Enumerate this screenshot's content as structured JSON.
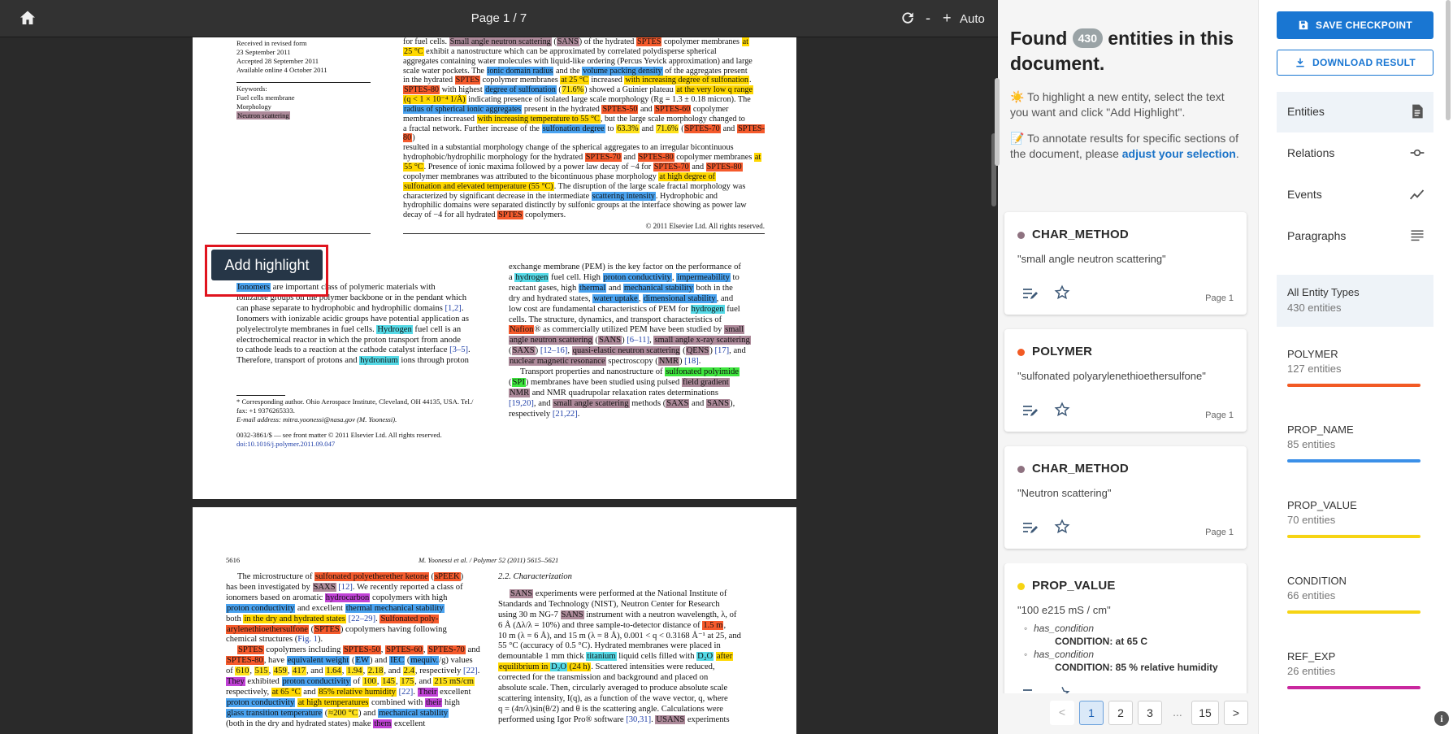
{
  "toolbar": {
    "page_label": "Page 1 / 7",
    "zoom_out": "-",
    "zoom_in": "+",
    "zoom_mode": "Auto"
  },
  "add_highlight": {
    "label": "Add highlight"
  },
  "summary": {
    "found_prefix": "Found",
    "count": "430",
    "found_suffix": "entities in this document.",
    "tip1": "To highlight a new entity, select the text you want and click \"Add Highlight\".",
    "tip2_prefix": "To annotate results for specific sections of the document, please",
    "tip2_link": "adjust your selection",
    "tip2_suffix": ".",
    "tip1_emoji": "☀️",
    "tip2_emoji": "📝"
  },
  "cards": [
    {
      "type": "CHAR_METHOD",
      "text": "\"small angle neutron scattering\"",
      "page": "Page 1",
      "color": "#8e7280"
    },
    {
      "type": "POLYMER",
      "text": "\"sulfonated polyarylenethioethersulfone\"",
      "page": "Page 1",
      "color": "#f25a24"
    },
    {
      "type": "CHAR_METHOD",
      "text": "\"Neutron scattering\"",
      "page": "Page 1",
      "color": "#8e7280"
    },
    {
      "type": "PROP_VALUE",
      "text": "\"100 e215 mS / cm\"",
      "page": "",
      "color": "#f6d413",
      "conditions": [
        {
          "key": "has_condition",
          "value": "CONDITION: at 65 C"
        },
        {
          "key": "has_condition",
          "value": "CONDITION: 85 % relative humidity"
        }
      ]
    }
  ],
  "pagination": {
    "prev": "<",
    "pages": [
      "1",
      "2",
      "3"
    ],
    "dots": "...",
    "last": "15",
    "next": ">"
  },
  "sidebar": {
    "save": "SAVE CHECKPOINT",
    "download": "DOWNLOAD RESULT",
    "nav": [
      {
        "label": "Entities",
        "icon": "document-icon"
      },
      {
        "label": "Relations",
        "icon": "relation-icon"
      },
      {
        "label": "Events",
        "icon": "trend-icon"
      },
      {
        "label": "Paragraphs",
        "icon": "paragraph-icon"
      }
    ],
    "all_types": {
      "label": "All Entity Types",
      "count": "430 entities"
    },
    "types": [
      {
        "name": "POLYMER",
        "count": "127 entities",
        "color": "#f25a24"
      },
      {
        "name": "PROP_NAME",
        "count": "85 entities",
        "color": "#3b90e8"
      },
      {
        "name": "PROP_VALUE",
        "count": "70 entities",
        "color": "#f6d413"
      },
      {
        "name": "CONDITION",
        "count": "66 entities",
        "color": "#f6d413"
      },
      {
        "name": "REF_EXP",
        "count": "26 entities",
        "color": "#c9279e"
      }
    ]
  },
  "doc": {
    "p1_history": [
      "Received in revised form",
      "23 September 2011",
      "Accepted 28 September 2011",
      "Available online 4 October 2011"
    ],
    "p1_keywords_title": "Keywords:",
    "p1_keywords": [
      "Fuel cells membrane",
      "Morphology",
      "Neutron scattering"
    ],
    "p1_abs_lines": [
      "for fuel cells. Small angle neutron scattering (SANS) of the hydrated SPTES copolymer membranes at",
      "25 °C exhibit a nanostructure which can be approximated by correlated polydisperse spherical",
      "aggregates containing water molecules with liquid-like ordering (Percus Yevick approximation) and large",
      "scale water pockets. The ionic domain radius and the volume packing density of the aggregates present",
      "in the hydrated SPTES copolymer membranes at 25 °C increased with increasing degree of sulfonation.",
      "SPTES-80 with highest degree of sulfonation (71.6%) showed a Guinier plateau at the very low q range",
      "(q < 1 × 10⁻⁴ 1/Å) indicating presence of isolated large scale morphology (Rg = 1.3 ± 0.18 micron). The",
      "radius of spherical ionic aggregates present in the hydrated SPTES-50 and SPTES-60 copolymer",
      "membranes increased with increasing temperature to 55 °C, but the large scale morphology changed to",
      "a fractal network. Further increase of the sulfonation degree to 63.3% and 71.6% (SPTES-70 and SPTES-80)",
      "resulted in a substantial morphology change of the spherical aggregates to an irregular bicontinuous",
      "hydrophobic/hydrophilic morphology for the hydrated SPTES-70 and SPTES-80 copolymer membranes at",
      "55 °C. Presence of ionic maxima followed by a power law decay of −4 for SPTES-70 and SPTES-80",
      "copolymer membranes was attributed to the bicontinuous phase morphology at high degree of",
      "sulfonation and elevated temperature (55 °C). The disruption of the large scale fractal morphology was",
      "characterized by significant decrease in the intermediate scattering intensity. Hydrophobic and",
      "hydrophilic domains were separated distinctly by sulfonic groups at the interface showing as power law",
      "decay of −4 for all hydrated SPTES copolymers."
    ],
    "p1_copyright": "© 2011 Elsevier Ltd. All rights reserved.",
    "p1_intro_left": [
      "Ionomers are important class of polymeric materials with",
      "ionizable groups on the polymer backbone or in the pendant which",
      "can phase separate to hydrophobic and hydrophilic domains [1,2].",
      "Ionomers with ionizable acidic groups have potential application as",
      "polyelectrolyte membranes in fuel cells. Hydrogen fuel cell is an",
      "electrochemical reactor in which the proton transport from anode",
      "to cathode leads to a reaction at the cathode catalyst interface [3–5].",
      "Therefore, transport of protons and hydronium ions through proton"
    ],
    "p1_footnote": [
      "* Corresponding author. Ohio Aerospace Institute, Cleveland, OH 44135, USA. Tel./",
      "fax: +1 9376265333.",
      "E-mail address: mitra.yoonessi@nasa.gov (M. Yoonessi)."
    ],
    "p1_doi": [
      "0032-3861/$ — see front matter © 2011 Elsevier Ltd. All rights reserved.",
      "doi:10.1016/j.polymer.2011.09.047"
    ],
    "p1_intro_right": [
      "exchange membrane (PEM) is the key factor on the performance of",
      "a hydrogen fuel cell. High proton conductivity, impermeability to",
      "reactant gases, high thermal and mechanical stability both in the",
      "dry and hydrated states, water uptake, dimensional stability, and",
      "low cost are fundamental characteristics of PEM for hydrogen fuel",
      "cells. The structure, dynamics, and transport characteristics of",
      "Nafion® as commercially utilized PEM have been studied by small",
      "angle neutron scattering (SANS) [6–11], small angle x-ray scattering",
      "(SAXS) [12–16], quasi-elastic neutron scattering (QENS) [17], and",
      "nuclear magnetic resonance spectroscopy (NMR) [18].",
      "Transport properties and nanostructure of sulfonated polyimide",
      "(SPI) membranes have been studied using pulsed field gradient",
      "NMR and NMR quadrupolar relaxation rates determinations",
      "[19,20], and small angle scattering methods (SAXS and SANS),",
      "respectively [21,22]."
    ],
    "p2_pagenum": "5616",
    "p2_header": "M. Yoonessi et al. / Polymer 52 (2011) 5615–5621",
    "p2_left": [
      "The microstructure of sulfonated polyetherether ketone (sPEEK)",
      "has been investigated by SAXS [12]. We recently reported a class of",
      "ionomers based on aromatic hydrocarbon copolymers with high",
      "proton conductivity and excellent thermal mechanical stability",
      "both in the dry and hydrated states [22–29]. Sulfonated poly-",
      "arylenethioethersulfone (SPTES) copolymers having following",
      "chemical structures (Fig. 1).",
      "SPTES copolymers including SPTES-50, SPTES-60, SPTES-70 and",
      "SPTES-80, have equivalent weight (EW) and IEC (mequiv./g) values",
      "of 610, 515, 459, 417, and 1.64, 1.94, 2.18, and 2.4, respectively [22].",
      "They exhibited proton conductivity of 100, 145, 175, and 215 mS/cm",
      "respectively, at 65 °C and 85% relative humidity [22]. Their excellent",
      "proton conductivity at high temperatures combined with their high",
      "glass transition temperature (≈200 °C) and mechanical stability",
      "(both in the dry and hydrated states) make them excellent"
    ],
    "p2_right_title": "2.2. Characterization",
    "p2_right": [
      "SANS experiments were performed at the National Institute of",
      "Standards and Technology (NIST), Neutron Center for Research",
      "using 30 m NG-7 SANS instrument with a neutron wavelength, λ, of",
      "6 Å (Δλ/λ = 10%) and three sample-to-detector distance of 1.5 m,",
      "10 m (λ = 6 Å), and 15 m (λ = 8 Å), 0.001 < q < 0.3168 Å⁻¹ at 25, and",
      "55 °C (accuracy of 0.5 °C). Hydrated membranes were placed in",
      "demountable 1 mm thick titanium liquid cells filled with D₂O after",
      "equilibrium in D₂O (24 h). Scattered intensities were reduced,",
      "corrected for the transmission and background and placed on",
      "absolute scale. Then, circularly averaged to produce absolute scale",
      "scattering intensity, I(q), as a function of the wave vector, q, where",
      "q = (4π/λ)sin(θ/2) and θ is the scattering angle. Calculations were",
      "performed using Igor Pro® software [30,31]. USANS experiments"
    ]
  }
}
